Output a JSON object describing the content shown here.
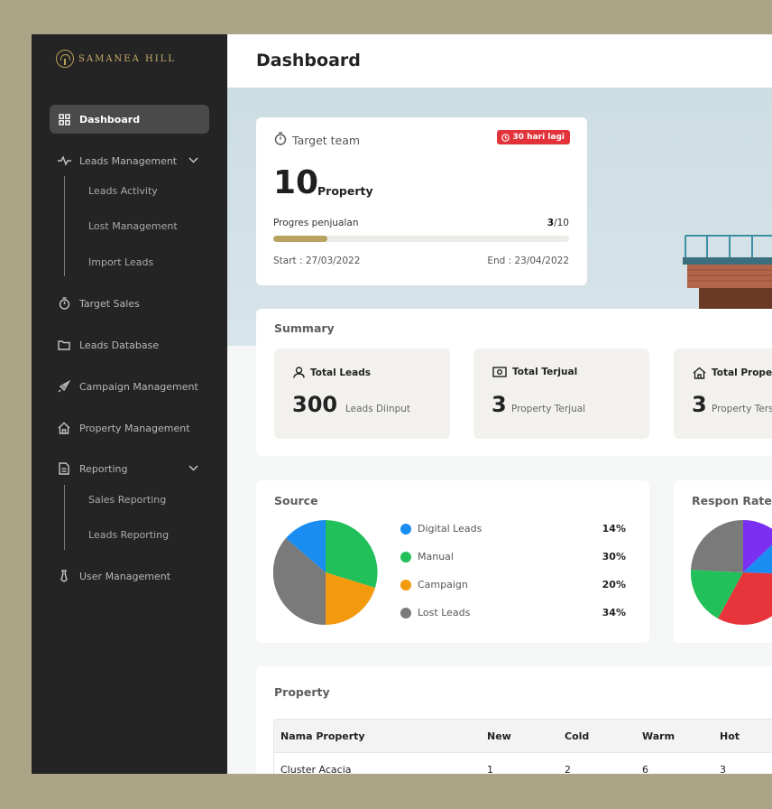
{
  "brand": {
    "name": "SAMANEA HILL"
  },
  "sidebar": {
    "items": [
      {
        "label": "Dashboard",
        "icon": "grid-icon"
      },
      {
        "label": "Leads Management",
        "icon": "activity-icon"
      },
      {
        "label": "Target Sales",
        "icon": "timer-icon"
      },
      {
        "label": "Leads Database",
        "icon": "folder-icon"
      },
      {
        "label": "Campaign Management",
        "icon": "rocket-icon"
      },
      {
        "label": "Property Management",
        "icon": "home-icon"
      },
      {
        "label": "Reporting",
        "icon": "report-icon"
      },
      {
        "label": "User Management",
        "icon": "tie-icon"
      }
    ],
    "leads_sub": [
      "Leads Activity",
      "Lost Management",
      "Import Leads"
    ],
    "reporting_sub": [
      "Sales Reporting",
      "Leads Reporting"
    ]
  },
  "header": {
    "title": "Dashboard"
  },
  "target": {
    "title": "Target team",
    "badge": "30 hari lagi",
    "number": "10",
    "unit": "Property",
    "progress_label": "Progres penjualan",
    "progress_done": "3",
    "progress_total": "/10",
    "progress_fraction": 0.3,
    "start": "Start : 27/03/2022",
    "end": "End : 23/04/2022"
  },
  "summary": {
    "title": "Summary",
    "stats": [
      {
        "label": "Total Leads",
        "value": "300",
        "sub": "Leads Diinput"
      },
      {
        "label": "Total Terjual",
        "value": "3",
        "sub": "Property Terjual"
      },
      {
        "label": "Total Property",
        "value": "3",
        "sub": "Property Tersedia"
      }
    ]
  },
  "source": {
    "title": "Source",
    "legend": [
      {
        "label": "Digital Leads",
        "pct": "14%",
        "color": "#1a8df2"
      },
      {
        "label": "Manual",
        "pct": "30%",
        "color": "#22c05a"
      },
      {
        "label": "Campaign",
        "pct": "20%",
        "color": "#f39a0e"
      },
      {
        "label": "Lost Leads",
        "pct": "34%",
        "color": "#7a7a7a"
      }
    ]
  },
  "respon": {
    "title": "Respon Rate"
  },
  "property": {
    "title": "Property",
    "columns": [
      "Nama Property",
      "New",
      "Cold",
      "Warm",
      "Hot"
    ],
    "rows": [
      [
        "Cluster Acacia",
        "1",
        "2",
        "6",
        "3"
      ]
    ]
  },
  "colors": {
    "accent_gold": "#b7a35f",
    "sidebar_bg": "#242424",
    "badge_red": "#e2333a"
  }
}
